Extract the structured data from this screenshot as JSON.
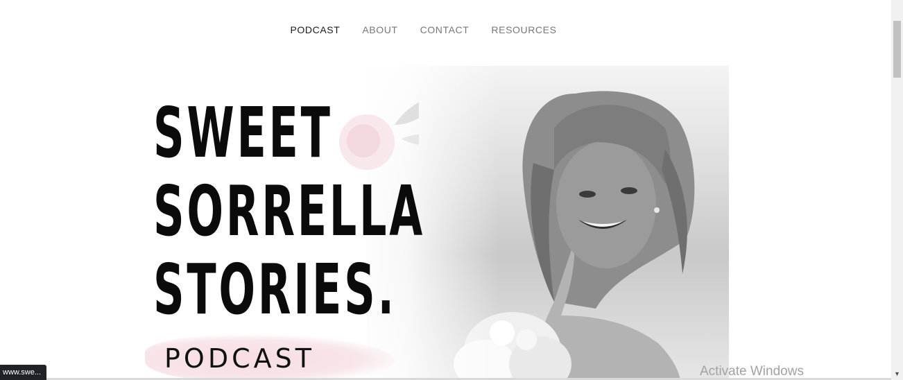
{
  "nav": {
    "items": [
      {
        "label": "PODCAST",
        "active": true
      },
      {
        "label": "ABOUT",
        "active": false
      },
      {
        "label": "CONTACT",
        "active": false
      },
      {
        "label": "RESOURCES",
        "active": false
      }
    ]
  },
  "hero": {
    "title_lines": [
      "SWEET",
      "SORRELLA",
      "STORIES."
    ],
    "subtitle": "PODCAST"
  },
  "status": {
    "link_text": "www.swe..."
  },
  "watermark": {
    "text": "Activate Windows"
  },
  "colors": {
    "nav_active": "#1a1a1a",
    "nav_inactive": "#777777",
    "title": "#0b0b0b",
    "brush_pink": "#f6dde2"
  }
}
